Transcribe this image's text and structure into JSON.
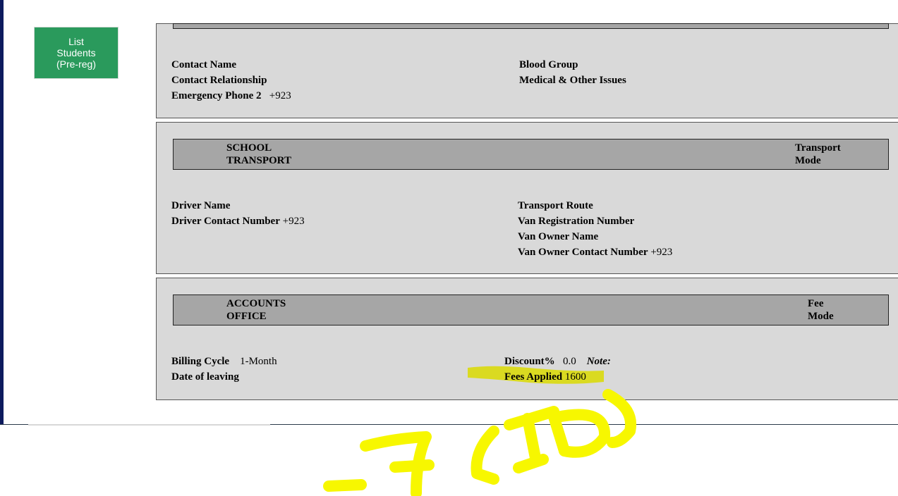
{
  "sidebar": {
    "list_students_label": "List\nStudents\n(Pre-reg)"
  },
  "emergency": {
    "contact_name": "Contact Name",
    "contact_relationship": "Contact Relationship",
    "emergency_phone_2": "Emergency Phone 2",
    "emergency_phone_2_value": "+923",
    "blood_group": "Blood Group",
    "medical_issues": "Medical & Other Issues"
  },
  "transport": {
    "header_left": "SCHOOL\nTRANSPORT",
    "header_right": "Transport\nMode",
    "driver_name": "Driver Name",
    "driver_contact": "Driver Contact Number",
    "driver_contact_value": "+923",
    "route": "Transport Route",
    "van_registration": "Van Registration Number",
    "van_owner_name": "Van Owner Name",
    "van_owner_contact": "Van Owner Contact Number",
    "van_owner_contact_value": "+923"
  },
  "accounts": {
    "header_left": "ACCOUNTS\nOFFICE",
    "header_right": "Fee\nMode",
    "billing_cycle": "Billing Cycle",
    "billing_cycle_value": "1-Month",
    "date_of_leaving": "Date of leaving",
    "discount": "Discount%",
    "discount_value": "0.0",
    "note": "Note:",
    "fees_applied": "Fees Applied",
    "fees_applied_value": "1600"
  },
  "annotation": {
    "text": "-7 (ID)",
    "color": "#f7f700",
    "highlight_color": "#d9d900"
  }
}
